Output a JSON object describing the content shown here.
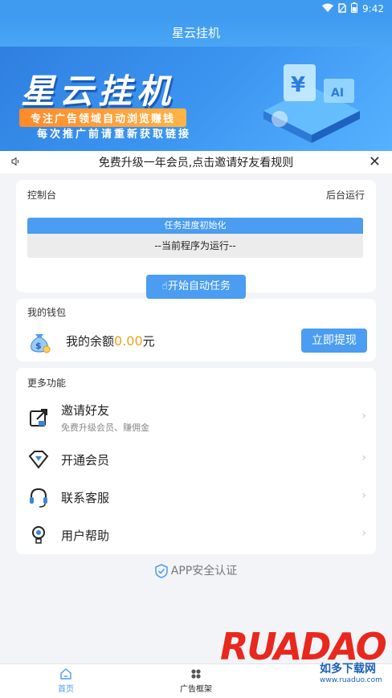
{
  "status_bar": {
    "time": "9:42",
    "icons": [
      "wifi-icon",
      "sim-icon",
      "battery-icon"
    ]
  },
  "app_bar": {
    "title": "星云挂机"
  },
  "banner": {
    "title": "星云挂机",
    "line1": "专注广告领域自动浏览赚钱",
    "line2": "每次推广前请重新获取链接"
  },
  "notice": {
    "text": "免费升级一年会员,点击邀请好友看规则",
    "icon": "speaker-icon",
    "close_icon": "close-icon"
  },
  "console": {
    "title": "控制台",
    "status": "后台运行",
    "progress_label": "任务进度初始化",
    "program_status": "--当前程序为运行--",
    "start_button": "开始自动任务"
  },
  "wallet": {
    "title": "我的钱包",
    "balance_prefix": "我的余额",
    "balance": "0.00",
    "balance_suffix": "元",
    "withdraw_button": "立即提现"
  },
  "more": {
    "title": "更多功能",
    "items": [
      {
        "label": "邀请好友",
        "sublabel": "免费升级会员、赚佣金",
        "icon": "share-icon"
      },
      {
        "label": "开通会员",
        "sublabel": "",
        "icon": "diamond-icon"
      },
      {
        "label": "联系客服",
        "sublabel": "",
        "icon": "headset-icon"
      },
      {
        "label": "用户帮助",
        "sublabel": "",
        "icon": "lightbulb-icon"
      }
    ]
  },
  "security": {
    "text": "APP安全认证",
    "icon": "shield-check-icon"
  },
  "tabs": [
    {
      "label": "首页",
      "icon": "home-icon",
      "active": true
    },
    {
      "label": "广告框架",
      "icon": "grid-icon",
      "active": false
    }
  ],
  "watermark": {
    "brand": "RUADAO",
    "cn": "如多下载网",
    "url": "www.ruaduo.com"
  },
  "colors": {
    "primary": "#4a9df0",
    "amount": "#f2a21b",
    "background": "#f2f4f7"
  }
}
